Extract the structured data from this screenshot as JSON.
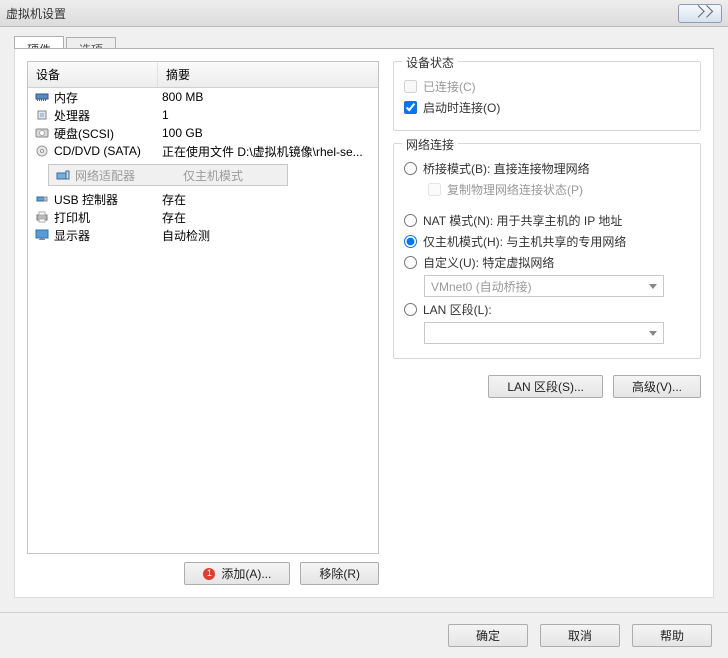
{
  "title": "虚拟机设置",
  "tabs": {
    "hardware": "硬件",
    "options": "选项"
  },
  "list": {
    "col_device": "设备",
    "col_summary": "摘要",
    "rows": [
      {
        "icon": "memory-icon",
        "device": "内存",
        "summary": "800 MB"
      },
      {
        "icon": "cpu-icon",
        "device": "处理器",
        "summary": "1"
      },
      {
        "icon": "disk-icon",
        "device": "硬盘(SCSI)",
        "summary": "100 GB"
      },
      {
        "icon": "cd-icon",
        "device": "CD/DVD (SATA)",
        "summary": "正在使用文件 D:\\虚拟机镜像\\rhel-se..."
      },
      {
        "icon": "network-icon",
        "device": "网络适配器",
        "summary": "仅主机模式"
      },
      {
        "icon": "usb-icon",
        "device": "USB 控制器",
        "summary": "存在"
      },
      {
        "icon": "printer-icon",
        "device": "打印机",
        "summary": "存在"
      },
      {
        "icon": "monitor-icon",
        "device": "显示器",
        "summary": "自动检测"
      }
    ],
    "selected": 4
  },
  "buttons": {
    "add_mark": "1",
    "add": "添加(A)...",
    "remove": "移除(R)",
    "ok": "确定",
    "cancel": "取消",
    "help": "帮助",
    "lanseg": "LAN 区段(S)...",
    "advanced": "高级(V)..."
  },
  "device_status": {
    "legend": "设备状态",
    "connected": "已连接(C)",
    "connect_on_power": "启动时连接(O)"
  },
  "netconn": {
    "legend": "网络连接",
    "bridged": "桥接模式(B): 直接连接物理网络",
    "replicate": "复制物理网络连接状态(P)",
    "nat": "NAT 模式(N): 用于共享主机的 IP 地址",
    "hostonly": "仅主机模式(H): 与主机共享的专用网络",
    "custom": "自定义(U): 特定虚拟网络",
    "custom_sel": "VMnet0 (自动桥接)",
    "lanseg": "LAN 区段(L):",
    "lanseg_sel": ""
  }
}
